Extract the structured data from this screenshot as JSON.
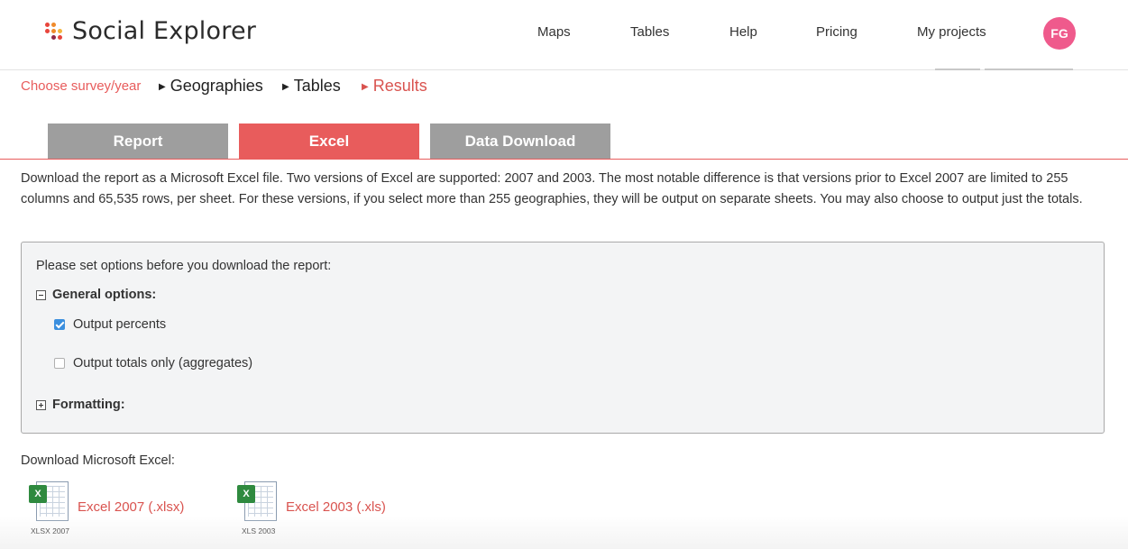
{
  "colors": {
    "accent": "#e85c5c",
    "link": "#d9534f",
    "tab_inactive": "#9e9e9e",
    "avatar": "#ef5a8c"
  },
  "header": {
    "logo_text": "Social Explorer",
    "nav": [
      "Maps",
      "Tables",
      "Help",
      "Pricing",
      "My projects"
    ],
    "avatar_initials": "FG"
  },
  "breadcrumb": {
    "step1": "Choose survey/year",
    "step2": "Geographies",
    "step3": "Tables",
    "step4": "Results"
  },
  "tabs": [
    {
      "label": "Report",
      "active": false
    },
    {
      "label": "Excel",
      "active": true
    },
    {
      "label": "Data Download",
      "active": false
    }
  ],
  "description": "Download the report as a Microsoft Excel file. Two versions of Excel are supported: 2007 and 2003. The most notable difference is that versions prior to Excel 2007 are limited to 255 columns and 65,535 rows, per sheet. For these versions, if you select more than 255 geographies, they will be output on separate sheets. You may also choose to output just the totals.",
  "options": {
    "intro": "Please set options before you download the report:",
    "general_label": "General options:",
    "output_percents": {
      "label": "Output percents",
      "checked": true
    },
    "output_totals": {
      "label": "Output totals only (aggregates)",
      "checked": false
    },
    "formatting_label": "Formatting:"
  },
  "download": {
    "title": "Download Microsoft Excel:",
    "items": [
      {
        "link": "Excel 2007 (.xlsx)",
        "caption": "XLSX 2007",
        "icon": "excel-file-icon"
      },
      {
        "link": "Excel 2003 (.xls)",
        "caption": "XLS 2003",
        "icon": "excel-file-icon"
      }
    ]
  }
}
